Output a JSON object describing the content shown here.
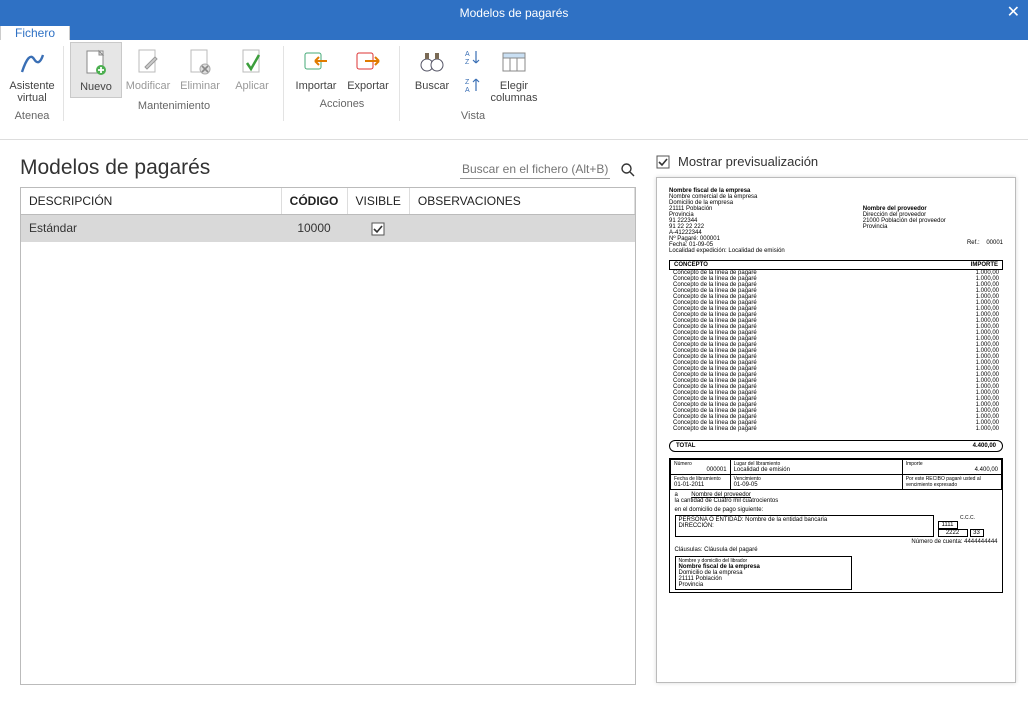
{
  "window": {
    "title": "Modelos de pagarés",
    "close": "✕"
  },
  "tabs": {
    "file": "Fichero"
  },
  "ribbon": {
    "atenea": {
      "asistente": "Asistente\nvirtual",
      "group": "Atenea"
    },
    "mant": {
      "nuevo": "Nuevo",
      "modificar": "Modificar",
      "eliminar": "Eliminar",
      "aplicar": "Aplicar",
      "group": "Mantenimiento"
    },
    "acc": {
      "importar": "Importar",
      "exportar": "Exportar",
      "group": "Acciones"
    },
    "vista": {
      "buscar": "Buscar",
      "elegir": "Elegir\ncolumnas",
      "group": "Vista"
    }
  },
  "list": {
    "heading": "Modelos de pagarés",
    "search_placeholder": "Buscar en el fichero (Alt+B)",
    "columns": {
      "desc": "DESCRIPCIÓN",
      "code": "CÓDIGO",
      "visible": "VISIBLE",
      "obs": "OBSERVACIONES"
    },
    "rows": [
      {
        "desc": "Estándar",
        "code": "10000",
        "visible": true,
        "obs": ""
      }
    ]
  },
  "preview": {
    "show_label": "Mostrar previsualización",
    "show_checked": true,
    "company_fiscal": "Nombre fiscal de la empresa",
    "company_comercial": "Nombre comercial de la empresa",
    "company_domicilio": "Domicilio de la empresa",
    "company_cp_pob": "21111    Población",
    "company_prov": "Provincia",
    "company_tel": "91 222344",
    "company_fax": "91 22 22 222",
    "company_nif": "A-41222344",
    "np_label": "Nº Pagaré:",
    "np_value": "000001",
    "fecha_label": "Fecha:",
    "fecha_value": "01-09-05",
    "locexp_label": "Localidad expedición:",
    "locexp_value": "Localidad de emisión",
    "prov_name": "Nombre del proveedor",
    "prov_dir": "Dirección del proveedor",
    "prov_cp": "21000    Población del proveedor",
    "prov_prov": "Provincia",
    "ref_label": "Ref.:",
    "ref_value": "00001",
    "col_concepto": "CONCEPTO",
    "col_importe": "IMPORTE",
    "line_concept": "Concepto de la línea de pagaré",
    "line_amount": "1.000,00",
    "line_count": 27,
    "total_label": "TOTAL",
    "total_value": "4.400,00",
    "rcpt_numero_label": "Número",
    "rcpt_numero": "000001",
    "rcpt_lugar_label": "Lugar del libramiento",
    "rcpt_lugar": "Localidad de emisión",
    "rcpt_importe_label": "Importe",
    "rcpt_importe": "4.400,00",
    "rcpt_fechalib_label": "Fecha de libramiento",
    "rcpt_fechalib": "01-01-2011",
    "rcpt_venc_label": "Vencimiento",
    "rcpt_venc": "01-09-05",
    "rcpt_por": "Por este RECIBO pagaré usted al vencimiento expresado",
    "rcpt_a": "a",
    "rcpt_a_val": "Nombre del proveedor",
    "rcpt_cant": "la cantidad de Cuatro mil cuatrocientos",
    "rcpt_domlabel": "en el domicilio de pago siguiente:",
    "rcpt_persona": "PERSONA O ENTIDAD: Nombre de la entidad bancaria",
    "rcpt_direccion": "DIRECCIÓN:",
    "rcpt_ccc": "C.C.C.",
    "rcpt_ccc1": "1111",
    "rcpt_ccc2": "2222",
    "rcpt_ccc3": "33",
    "rcpt_numcuenta_label": "Número de cuenta:",
    "rcpt_numcuenta": "4444444444",
    "rcpt_clausulas": "Cláusulas: Cláusula del pagaré",
    "rcpt_firma_label": "Nombre y domicilio del librador",
    "rcpt_firma_name": "Nombre fiscal de la empresa",
    "rcpt_firma_dom": "Domicilio de la empresa",
    "rcpt_firma_cp": "21111    Población",
    "rcpt_firma_prov": "Provincia"
  }
}
